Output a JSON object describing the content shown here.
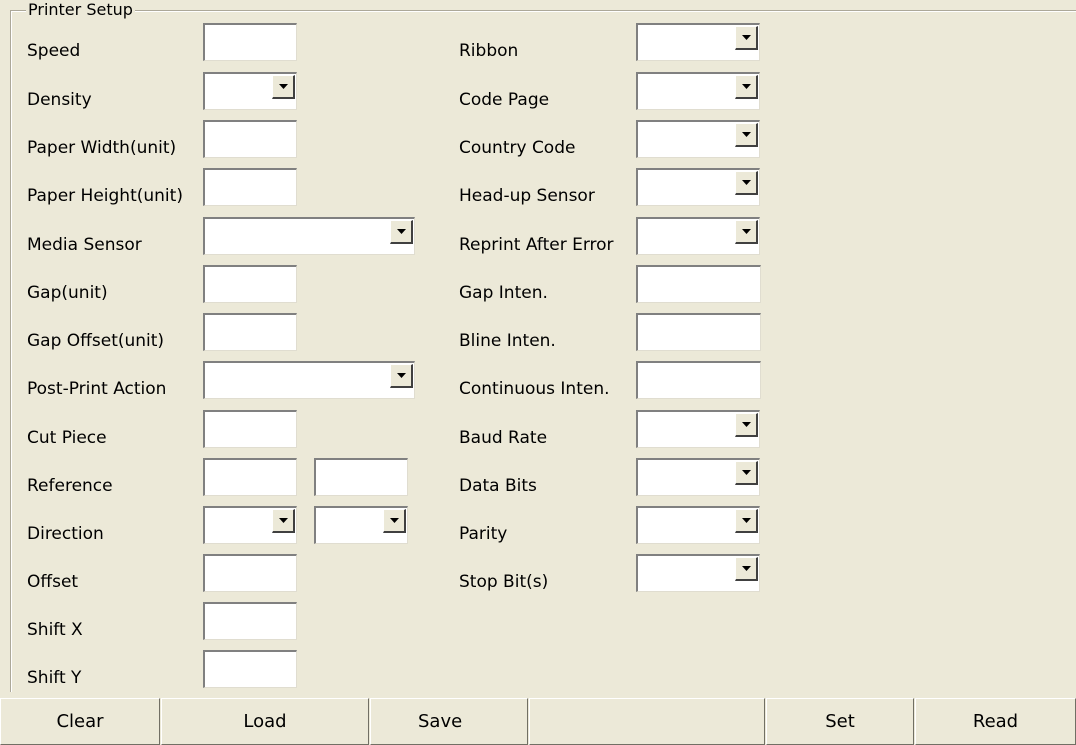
{
  "window": {
    "group_title": "Printer Setup"
  },
  "left_fields": [
    {
      "label": "Speed",
      "type": "text",
      "value": ""
    },
    {
      "label": "Density",
      "type": "combo",
      "value": ""
    },
    {
      "label": "Paper Width(unit)",
      "type": "text",
      "value": ""
    },
    {
      "label": "Paper Height(unit)",
      "type": "text",
      "value": ""
    },
    {
      "label": "Media Sensor",
      "type": "combo",
      "value": ""
    },
    {
      "label": "Gap(unit)",
      "type": "text",
      "value": ""
    },
    {
      "label": "Gap Offset(unit)",
      "type": "text",
      "value": ""
    },
    {
      "label": "Post-Print Action",
      "type": "combo",
      "value": ""
    },
    {
      "label": "Cut Piece",
      "type": "text",
      "value": ""
    },
    {
      "label": "Reference",
      "type": "text-pair",
      "value": "",
      "value2": ""
    },
    {
      "label": "Direction",
      "type": "combo-pair",
      "value": "",
      "value2": ""
    },
    {
      "label": "Offset",
      "type": "text",
      "value": ""
    },
    {
      "label": "Shift X",
      "type": "text",
      "value": ""
    },
    {
      "label": "Shift Y",
      "type": "text",
      "value": ""
    }
  ],
  "right_fields": [
    {
      "label": "Ribbon",
      "type": "combo",
      "value": ""
    },
    {
      "label": "Code Page",
      "type": "combo",
      "value": ""
    },
    {
      "label": "Country Code",
      "type": "combo",
      "value": ""
    },
    {
      "label": "Head-up Sensor",
      "type": "combo",
      "value": ""
    },
    {
      "label": "Reprint After Error",
      "type": "combo",
      "value": ""
    },
    {
      "label": "Gap Inten.",
      "type": "text",
      "value": ""
    },
    {
      "label": "Bline Inten.",
      "type": "text",
      "value": ""
    },
    {
      "label": "Continuous Inten.",
      "type": "text",
      "value": ""
    },
    {
      "label": "Baud Rate",
      "type": "combo",
      "value": ""
    },
    {
      "label": "Data Bits",
      "type": "combo",
      "value": ""
    },
    {
      "label": "Parity",
      "type": "combo",
      "value": ""
    },
    {
      "label": "Stop Bit(s)",
      "type": "combo",
      "value": ""
    }
  ],
  "buttons": {
    "clear": "Clear",
    "load": "Load",
    "save": "Save",
    "set": "Set",
    "read": "Read"
  },
  "icons": {
    "dropdown": "chevron-down-icon"
  },
  "colors": {
    "background": "#ece9d8",
    "field": "#ffffff",
    "field_border": "#808080"
  }
}
